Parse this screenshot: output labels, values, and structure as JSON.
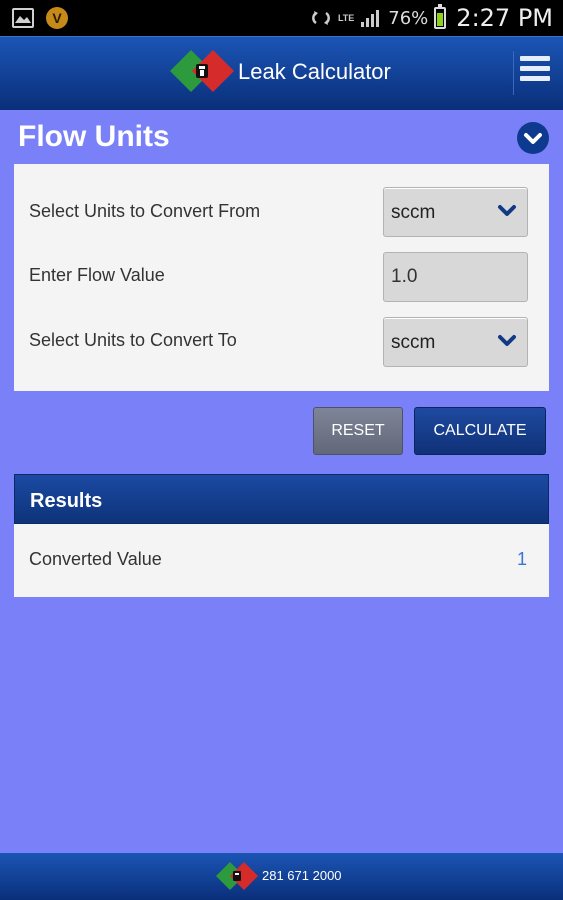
{
  "status_bar": {
    "battery": "76%",
    "network": "LTE",
    "time": "2:27 PM"
  },
  "header": {
    "title": "Leak Calculator"
  },
  "section": {
    "title": "Flow Units"
  },
  "form": {
    "from_label": "Select Units to Convert From",
    "from_value": "sccm",
    "value_label": "Enter Flow Value",
    "value_input": "1.0",
    "to_label": "Select Units to Convert To",
    "to_value": "sccm"
  },
  "buttons": {
    "reset": "RESET",
    "calculate": "CALCULATE"
  },
  "results": {
    "title": "Results",
    "label": "Converted Value",
    "value": "1"
  },
  "footer": {
    "phone": "281 671 2000"
  },
  "colors": {
    "background": "#7a80f8",
    "header": "#0d3a8f",
    "accent_link": "#3a73d8"
  }
}
